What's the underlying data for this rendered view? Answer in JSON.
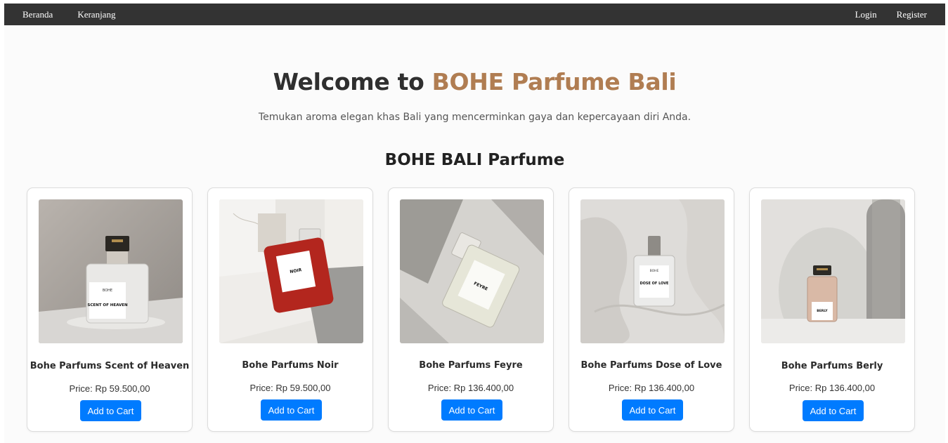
{
  "nav": {
    "home": "Beranda",
    "cart": "Keranjang",
    "login": "Login",
    "register": "Register"
  },
  "hero": {
    "title_prefix": "Welcome to ",
    "title_brand": "BOHE Parfume Bali",
    "subtitle": "Temukan aroma elegan khas Bali yang mencerminkan gaya dan kepercayaan diri Anda."
  },
  "section_title": "BOHE BALI Parfume",
  "products": [
    {
      "name": "Bohe Parfums Scent of Heaven",
      "price": "Price: Rp 59.500,00",
      "button": "Add to Cart",
      "bottle_label": "SCENT OF HEAVEN"
    },
    {
      "name": "Bohe Parfums Noir",
      "price": "Price: Rp 59.500,00",
      "button": "Add to Cart",
      "bottle_label": "NOIR"
    },
    {
      "name": "Bohe Parfums Feyre",
      "price": "Price: Rp 136.400,00",
      "button": "Add to Cart",
      "bottle_label": "FEYRE"
    },
    {
      "name": "Bohe Parfums Dose of Love",
      "price": "Price: Rp 136.400,00",
      "button": "Add to Cart",
      "bottle_label": "DOSE OF LOVE"
    },
    {
      "name": "Bohe Parfums Berly",
      "price": "Price: Rp 136.400,00",
      "button": "Add to Cart",
      "bottle_label": "BERLY"
    }
  ],
  "colors": {
    "navbar": "#333333",
    "brand_accent": "#b07d52",
    "button": "#007bff"
  }
}
